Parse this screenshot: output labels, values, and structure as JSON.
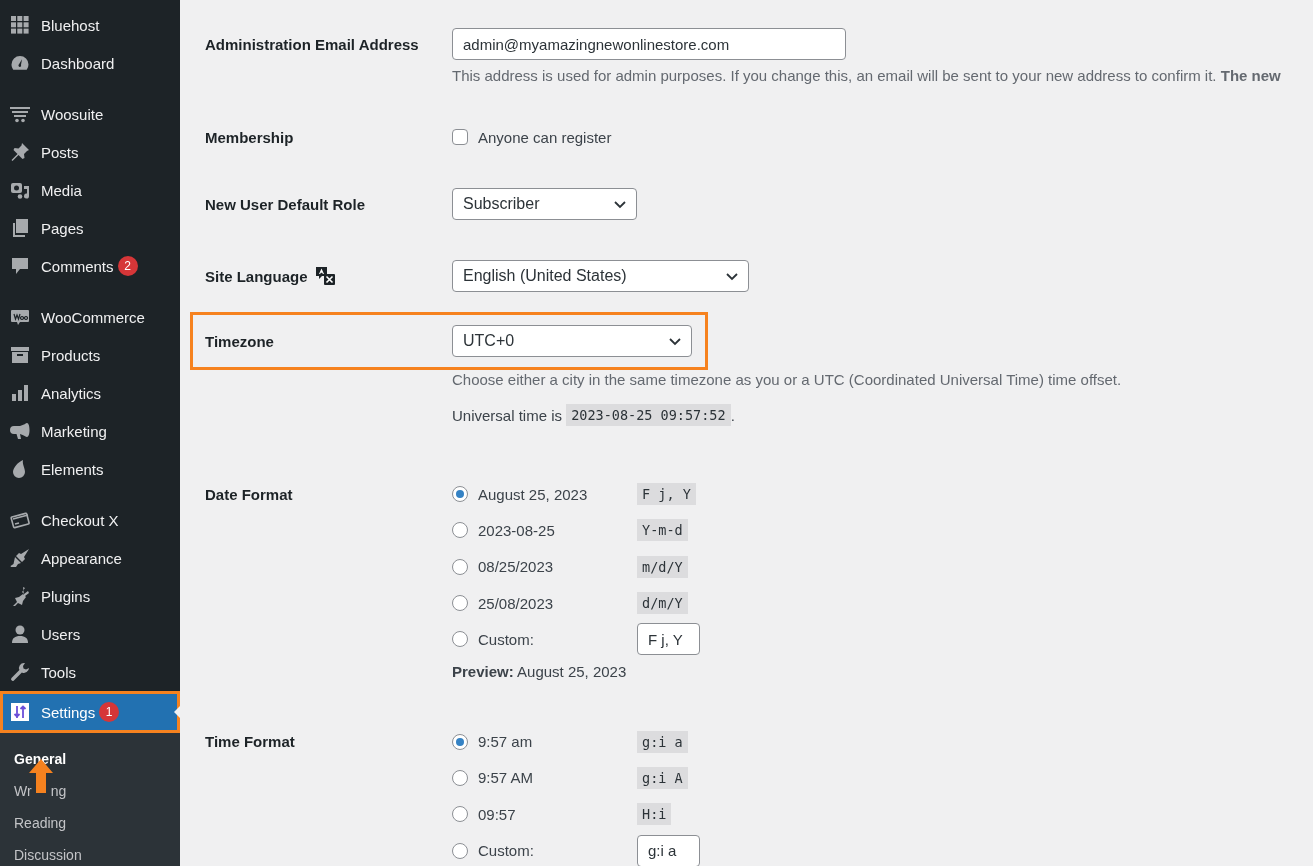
{
  "sidebar": {
    "groups": [
      [
        {
          "label": "Bluehost",
          "selected": false
        },
        {
          "label": "Dashboard",
          "selected": false
        }
      ],
      [
        {
          "label": "Woosuite",
          "selected": false
        },
        {
          "label": "Posts",
          "selected": false
        },
        {
          "label": "Media",
          "selected": false
        },
        {
          "label": "Pages",
          "selected": false
        },
        {
          "label": "Comments",
          "badge": "2",
          "selected": false
        }
      ],
      [
        {
          "label": "WooCommerce",
          "selected": false
        },
        {
          "label": "Products",
          "selected": false
        },
        {
          "label": "Analytics",
          "selected": false
        },
        {
          "label": "Marketing",
          "selected": false
        },
        {
          "label": "Elements",
          "selected": false
        }
      ],
      [
        {
          "label": "Checkout X",
          "selected": false
        },
        {
          "label": "Appearance",
          "selected": false
        },
        {
          "label": "Plugins",
          "selected": false
        },
        {
          "label": "Users",
          "selected": false
        },
        {
          "label": "Tools",
          "selected": false
        },
        {
          "label": "Settings",
          "badge": "1",
          "selected": true,
          "highlighted": true
        }
      ]
    ],
    "submenu": [
      {
        "label": "General",
        "selected": true,
        "pointed": true
      },
      {
        "label": "Wr",
        "label_end": "ng",
        "selected": false,
        "pointed": false
      },
      {
        "label": "Reading",
        "selected": false,
        "pointed": false
      },
      {
        "label": "Discussion",
        "selected": false,
        "pointed": false
      }
    ]
  },
  "fields": [
    {
      "kind": "text",
      "label": "Administration Email Address",
      "value": "admin@myamazingnewonlinestore.com",
      "description": "This address is used for admin purposes. If you change this, an email will be sent to your new address to confirm it. **The new**"
    },
    {
      "kind": "checkbox",
      "label": "Membership",
      "option": "Anyone can register",
      "checked": false
    },
    {
      "kind": "select",
      "label": "New User Default Role",
      "value": "Subscriber"
    },
    {
      "kind": "select",
      "label": "Site Language",
      "value": "English (United States)",
      "translate_icon": true
    },
    {
      "kind": "select",
      "label": "Timezone",
      "value": "UTC+0",
      "highlighted": true,
      "description": "Choose either a city in the same timezone as you or a UTC (Coordinated Universal Time) time offset.",
      "universal": {
        "text": "Universal time is",
        "time": "2023-08-25 09:57:52",
        "after": "."
      }
    },
    {
      "kind": "radio",
      "label": "Date Format",
      "options": [
        {
          "label": "August 25, 2023",
          "format": "F j, Y",
          "selected": true
        },
        {
          "label": "2023-08-25",
          "format": "Y-m-d",
          "selected": false
        },
        {
          "label": "08/25/2023",
          "format": "m/d/Y",
          "selected": false
        },
        {
          "label": "25/08/2023",
          "format": "d/m/Y",
          "selected": false
        }
      ],
      "custom": {
        "label": "Custom:",
        "value": "F j, Y",
        "selected": false
      },
      "preview": {
        "label": "Preview:",
        "value": "August 25, 2023"
      }
    },
    {
      "kind": "radio",
      "label": "Time Format",
      "options": [
        {
          "label": "9:57 am",
          "format": "g:i a",
          "selected": true
        },
        {
          "label": "9:57 AM",
          "format": "g:i A",
          "selected": false
        },
        {
          "label": "09:57",
          "format": "H:i",
          "selected": false
        }
      ],
      "custom": {
        "label": "Custom:",
        "value": "g:i a",
        "selected": false
      }
    }
  ]
}
